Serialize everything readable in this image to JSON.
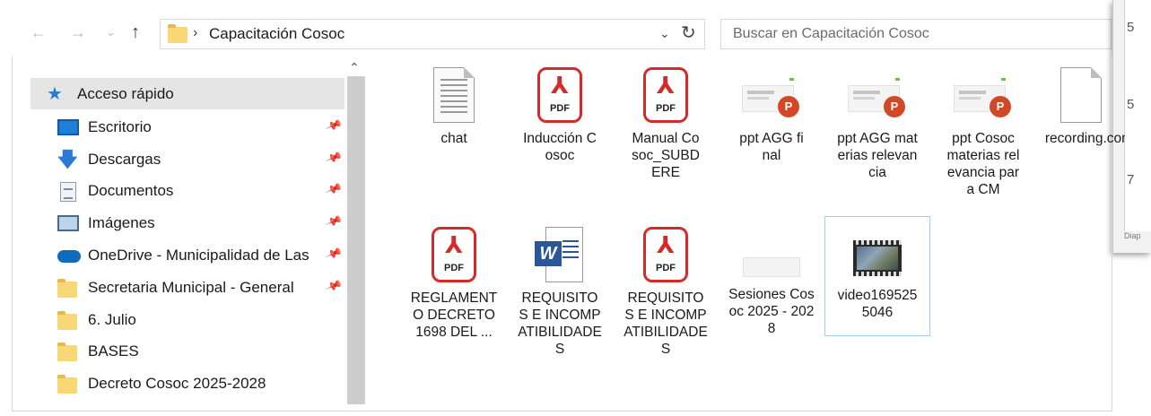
{
  "address_bar": {
    "path_folder": "Capacitación Cosoc",
    "separator": "›",
    "search_placeholder": "Buscar en Capacitación Cosoc",
    "back": "←",
    "forward": "→",
    "recent": "⌄",
    "up": "↑",
    "dropdown": "⌄",
    "refresh": "↻"
  },
  "side_window": {
    "numbers": [
      "5",
      "5",
      "7"
    ],
    "footer": "Diap"
  },
  "nav_pane": {
    "scroll_up": "⌃",
    "pin_glyph": "📌",
    "items": [
      {
        "label": "Acceso rápido",
        "icon": "star-icon",
        "pinned": false,
        "selected": true
      },
      {
        "label": "Escritorio",
        "icon": "desktop-icon",
        "pinned": true
      },
      {
        "label": "Descargas",
        "icon": "download-icon",
        "pinned": true
      },
      {
        "label": "Documentos",
        "icon": "documents-icon",
        "pinned": true
      },
      {
        "label": "Imágenes",
        "icon": "pictures-icon",
        "pinned": true
      },
      {
        "label": "OneDrive - Municipalidad de Las",
        "icon": "onedrive-icon",
        "pinned": true
      },
      {
        "label": "Secretaria Municipal - General",
        "icon": "folder-icon",
        "pinned": true
      },
      {
        "label": "6. Julio",
        "icon": "folder-icon",
        "pinned": false
      },
      {
        "label": "BASES",
        "icon": "folder-icon",
        "pinned": false
      },
      {
        "label": "Decreto Cosoc 2025-2028",
        "icon": "folder-icon",
        "pinned": false
      }
    ]
  },
  "files": [
    {
      "name": "chat",
      "icon": "text-file-icon"
    },
    {
      "name": "Inducción Cosoc",
      "icon": "pdf-icon"
    },
    {
      "name": "Manual Cosoc_SUBDERE",
      "icon": "pdf-icon"
    },
    {
      "name": "ppt AGG final",
      "icon": "powerpoint-icon"
    },
    {
      "name": "ppt AGG materias relevancia",
      "icon": "powerpoint-icon"
    },
    {
      "name": "ppt Cosoc materias relevancia para CM",
      "icon": "powerpoint-icon"
    },
    {
      "name": "recording.conf",
      "icon": "blank-file-icon"
    },
    {
      "name": "REGLAMENTO DECRETO 1698 DEL ...",
      "icon": "pdf-icon"
    },
    {
      "name": "REQUISITOS E INCOMPATIBILIDADES",
      "icon": "word-icon"
    },
    {
      "name": "REQUISITOS E INCOMPATIBILIDADES",
      "icon": "pdf-icon"
    },
    {
      "name": "Sesiones Cosoc 2025 - 2028",
      "icon": "spreadsheet-icon"
    },
    {
      "name": "video1695255046",
      "icon": "video-icon",
      "selected": true
    }
  ],
  "icon_text": {
    "pdf_symbol": "⅄",
    "pdf_label": "PDF",
    "ppt_letter": "P",
    "word_letter": "W",
    "star": "★",
    "download": "🡇"
  }
}
